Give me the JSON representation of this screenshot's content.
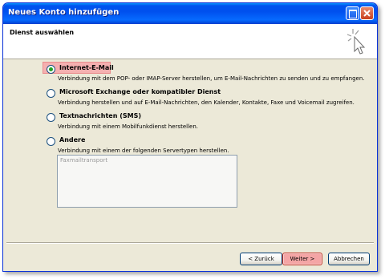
{
  "window": {
    "title": "Neues Konto hinzufügen"
  },
  "header": {
    "title": "Dienst auswählen",
    "icon": "wizard-wand-icon"
  },
  "options": [
    {
      "label": "Internet-E-Mail",
      "description": "Verbindung mit dem POP- oder IMAP-Server herstellen, um E-Mail-Nachrichten zu senden und zu empfangen.",
      "selected": true
    },
    {
      "label": "Microsoft Exchange oder kompatibler Dienst",
      "description": "Verbindung herstellen und auf E-Mail-Nachrichten, den Kalender, Kontakte, Faxe und Voicemail zugreifen.",
      "selected": false
    },
    {
      "label": "Textnachrichten (SMS)",
      "description": "Verbindung mit einem Mobilfunkdienst herstellen.",
      "selected": false
    },
    {
      "label": "Andere",
      "description": "Verbindung mit einem der folgenden Servertypen herstellen.",
      "selected": false
    }
  ],
  "server_types": [
    "Faxmailtransport"
  ],
  "buttons": {
    "back": "< Zurück",
    "next": "Weiter >",
    "cancel": "Abbrechen"
  },
  "colors": {
    "titlebar": "#0053ee",
    "highlight": "#f4a9a9",
    "dialog_bg": "#ece9d8"
  }
}
